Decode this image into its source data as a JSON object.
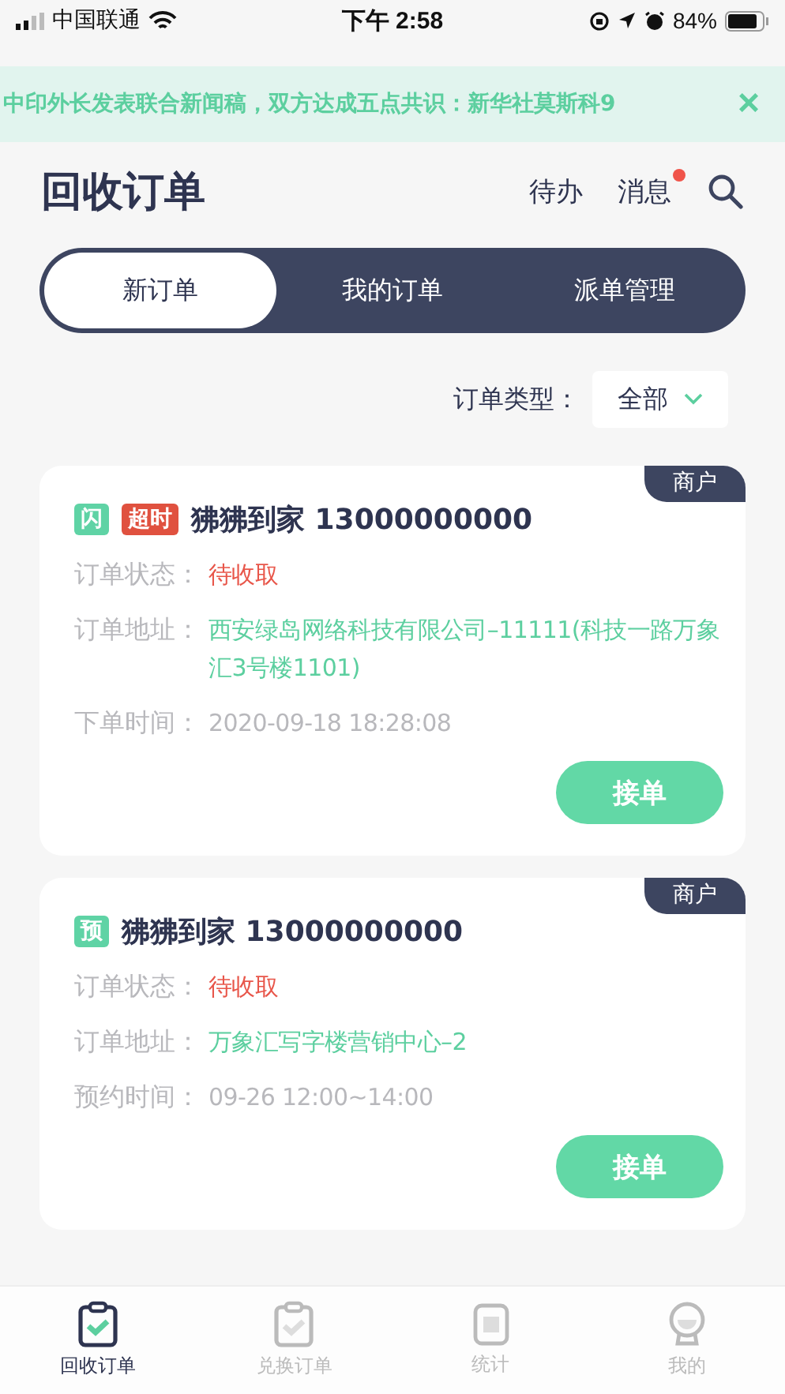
{
  "status_bar": {
    "carrier": "中国联通",
    "time": "下午 2:58",
    "battery": "84%"
  },
  "banner": {
    "text": "中印外长发表联合新闻稿，双方达成五点共识：新华社莫斯科9",
    "close": "×"
  },
  "header": {
    "title": "回收订单",
    "todo": "待办",
    "messages": "消息",
    "messages_unread": true
  },
  "tabs": [
    {
      "label": "新订单",
      "selected": true
    },
    {
      "label": "我的订单",
      "selected": false
    },
    {
      "label": "派单管理",
      "selected": false
    }
  ],
  "filter": {
    "label": "订单类型：",
    "value": "全部"
  },
  "orders": [
    {
      "corner": "商户",
      "tags": [
        {
          "text": "闪",
          "color": "#5fd3a5"
        },
        {
          "text": "超时",
          "color": "#e0513f"
        }
      ],
      "title": "狒狒到家 13000000000",
      "fields": [
        {
          "label": "订单状态：",
          "value": "待收取",
          "kind": "status"
        },
        {
          "label": "订单地址：",
          "value": "西安绿岛网络科技有限公司–11111(科技一路万象汇3号楼1101)",
          "kind": "address"
        },
        {
          "label": "下单时间：",
          "value": "2020-09-18 18:28:08",
          "kind": "time"
        }
      ],
      "button": "接单"
    },
    {
      "corner": "商户",
      "tags": [
        {
          "text": "预",
          "color": "#5fd3a5"
        }
      ],
      "title": "狒狒到家 13000000000",
      "fields": [
        {
          "label": "订单状态：",
          "value": "待收取",
          "kind": "status"
        },
        {
          "label": "订单地址：",
          "value": "万象汇写字楼营销中心–2",
          "kind": "address"
        },
        {
          "label": "预约时间：",
          "value": "09-26 12:00~14:00",
          "kind": "time"
        }
      ],
      "button": "接单"
    }
  ],
  "tabbar": [
    {
      "label": "回收订单",
      "kind": "clipboard",
      "selected": true
    },
    {
      "label": "兑换订单",
      "kind": "clipboard",
      "selected": false
    },
    {
      "label": "统计",
      "kind": "report",
      "selected": false
    },
    {
      "label": "我的",
      "kind": "profile",
      "selected": false
    }
  ]
}
